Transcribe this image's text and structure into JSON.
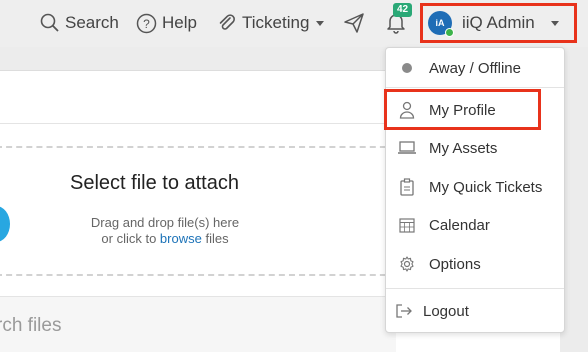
{
  "topbar": {
    "search_label": "Search",
    "help_label": "Help",
    "ticketing_label": "Ticketing",
    "notification_count": "42",
    "avatar_initials": "iA",
    "user_name": "iiQ Admin"
  },
  "content": {
    "drop_title": "Select file to attach",
    "drop_hint_line1": "Drag and drop file(s) here",
    "drop_hint_prefix": "or click to ",
    "drop_hint_link": "browse",
    "drop_hint_suffix": " files",
    "search_placeholder": "rch files"
  },
  "menu": {
    "status": "Away / Offline",
    "items": [
      {
        "label": "My Profile",
        "icon": "person-icon"
      },
      {
        "label": "My Assets",
        "icon": "laptop-icon"
      },
      {
        "label": "My Quick Tickets",
        "icon": "clipboard-icon"
      },
      {
        "label": "Calendar",
        "icon": "calendar-icon"
      },
      {
        "label": "Options",
        "icon": "gear-icon"
      }
    ],
    "logout": "Logout"
  },
  "colors": {
    "highlight": "#e8321b",
    "badge": "#2aa876",
    "link": "#1d73b8",
    "avatar": "#1f6db6"
  }
}
